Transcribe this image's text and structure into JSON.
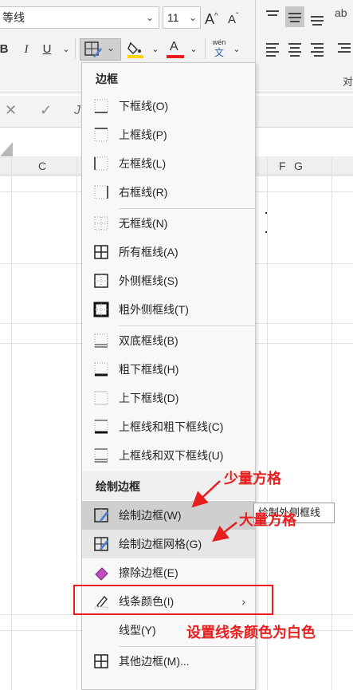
{
  "ribbon": {
    "font_name": "等线",
    "font_size": "11",
    "grow_font": "A^",
    "shrink_font": "Aˇ",
    "bold": "B",
    "italic": "I",
    "underline": "U",
    "wen_top": "wén",
    "wen_bottom": "文",
    "right_cut_label": "对"
  },
  "formula_bar": {
    "cancel": "✕",
    "enter": "✓",
    "fx": "J"
  },
  "columns": [
    "C",
    "F",
    "G"
  ],
  "menu": {
    "section_border": "边框",
    "section_draw": "绘制边框",
    "items": [
      {
        "label": "下框线(O)"
      },
      {
        "label": "上框线(P)"
      },
      {
        "label": "左框线(L)"
      },
      {
        "label": "右框线(R)"
      },
      {
        "label": "无框线(N)"
      },
      {
        "label": "所有框线(A)"
      },
      {
        "label": "外侧框线(S)"
      },
      {
        "label": "粗外侧框线(T)"
      },
      {
        "label": "双底框线(B)"
      },
      {
        "label": "粗下框线(H)"
      },
      {
        "label": "上下框线(D)"
      },
      {
        "label": "上框线和粗下框线(C)"
      },
      {
        "label": "上框线和双下框线(U)"
      }
    ],
    "draw_items": [
      {
        "label": "绘制边框(W)"
      },
      {
        "label": "绘制边框网格(G)"
      },
      {
        "label": "擦除边框(E)"
      },
      {
        "label": "线条颜色(I)"
      },
      {
        "label": "线型(Y)"
      },
      {
        "label": "其他边框(M)..."
      }
    ]
  },
  "tooltip": "绘制外侧框线",
  "annotations": {
    "few_cells": "少量方格",
    "many_cells": "大量方格",
    "set_color": "设置线条颜色为白色"
  },
  "colors": {
    "annotation_red": "#e81e1e",
    "fill_yellow": "#ffd400",
    "font_red": "#e81e1e"
  }
}
